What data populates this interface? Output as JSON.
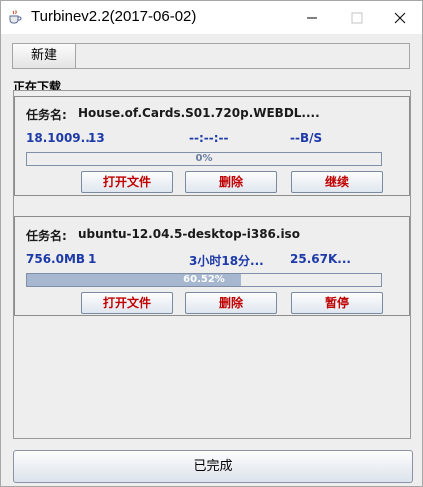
{
  "window": {
    "title": "Turbinev2.2(2017-06-02)"
  },
  "toolbar": {
    "new_label": "新建"
  },
  "section": {
    "downloading_label": "正在下载"
  },
  "tasks": [
    {
      "name_label": "任务名:",
      "name": "House.of.Cards.S01.720p.WEBDL....",
      "size": "18.1009...",
      "connections": "13",
      "remaining": "--:--:--",
      "speed": "--B/S",
      "progress_text": "0%",
      "progress_fraction": 0.0,
      "buttons": {
        "open": "打开文件",
        "delete": "删除",
        "action": "继续"
      }
    },
    {
      "name_label": "任务名:",
      "name": "ubuntu-12.04.5-desktop-i386.iso",
      "size": "756.0MB",
      "connections": "1",
      "remaining": "3小时18分...",
      "speed": "25.67K...",
      "progress_text": "60.52%",
      "progress_fraction": 0.6052,
      "buttons": {
        "open": "打开文件",
        "delete": "删除",
        "action": "暂停"
      }
    }
  ],
  "footer": {
    "completed_label": "已完成"
  },
  "colors": {
    "stat_text": "#1d3aa8",
    "button_text": "#c00000",
    "progress_fill": "#a6b7cf"
  }
}
